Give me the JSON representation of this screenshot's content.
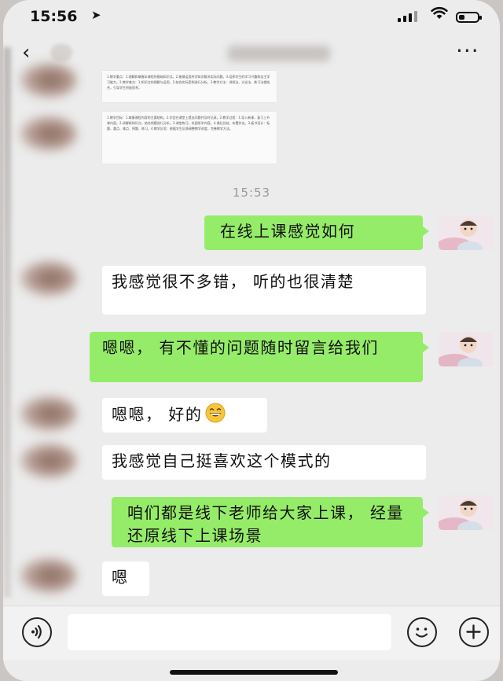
{
  "status_bar": {
    "time": "15:56",
    "location_icon": "location-arrow-icon",
    "signal_icon": "signal-bars-icon",
    "wifi_icon": "wifi-icon",
    "battery_icon": "battery-icon",
    "battery_level": 0.3
  },
  "nav": {
    "back_icon": "chevron-left-icon",
    "more_icon": "more-dots-icon"
  },
  "doc_images": [
    {
      "text": "1.教学重点：1.理解和掌握本课程的基础知识点。2.能够运用所学知识解决实际问题。3.培养学生的学习兴趣和自主学习能力。2.教学难点：1.知识点的理解与运用。2.结合实际案例进行分析。3.教学方法：讲授法、讨论法、练习法相结合，引导学生积极思考。"
    },
    {
      "text": "1.教学目标：1.掌握课程内容的主要结构。2.学会在课堂上提出问题并及时记录。2.教学过程：1.导入新课，复习上节课内容。2.讲解新知识点，结合例题进行分析。3.课堂练习，巩固所学内容。4.课后总结，布置作业。3.板书设计：标题、重点、难点、例题、练习。4.教学反思：根据学生反馈调整教学进度，完善教学方法。"
    }
  ],
  "timestamp": "15:53",
  "messages": [
    {
      "side": "out",
      "text": "在线上课感觉如何"
    },
    {
      "side": "in",
      "text": "我感觉很不多错， 听的也很清楚"
    },
    {
      "side": "out",
      "text": "嗯嗯， 有不懂的问题随时留言给我们"
    },
    {
      "side": "in",
      "text": "嗯嗯， 好的",
      "emoji": "grinning-emoji-icon"
    },
    {
      "side": "in",
      "text": "我感觉自己挺喜欢这个模式的"
    },
    {
      "side": "out",
      "text": "咱们都是线下老师给大家上课， 经量还原线下上课场景"
    },
    {
      "side": "in",
      "text": "嗯"
    }
  ],
  "input_bar": {
    "voice_icon": "voice-icon",
    "emoji_icon": "smile-icon",
    "plus_icon": "plus-icon",
    "input_value": ""
  },
  "colors": {
    "bubble_out": "#95ec69",
    "bubble_in": "#ffffff",
    "chat_background": "#ececec"
  }
}
